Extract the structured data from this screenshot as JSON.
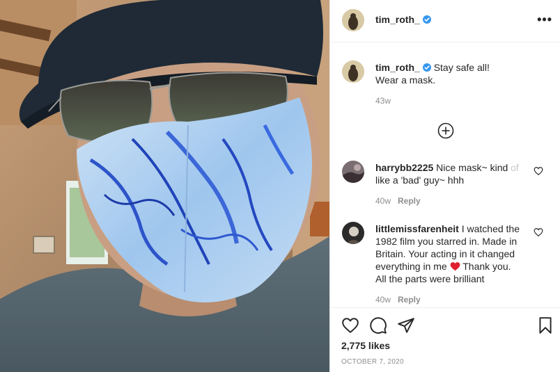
{
  "post": {
    "author": "tim_roth_",
    "more_label": "•••",
    "caption_line1": "Stay safe all!",
    "caption_line2": "Wear a mask.",
    "caption_time": "43w"
  },
  "comments": [
    {
      "user": "harrybb2225",
      "text_line1": "Nice mask~ kind ",
      "text_fade": "of",
      "text_line2": "like a 'bad' guy~ hhh",
      "time": "40w",
      "reply": "Reply"
    },
    {
      "user": "littlemissfarenheit",
      "text_line1": " I watched the",
      "text_line2": "1982 film you starred in. Made in",
      "text_line3": "Britain. Your acting in it changed",
      "text_line4": "everything in me ",
      "text_after_heart": " Thank you.",
      "text_line5": "All the parts were brilliant",
      "time": "40w",
      "reply": "Reply"
    }
  ],
  "stats": {
    "likes": "2,775 likes",
    "date": "OCTOBER 7, 2020"
  },
  "icons": {
    "verified": "verified-badge-icon",
    "load_more": "plus-circle-icon",
    "like": "heart-icon",
    "comment": "comment-bubble-icon",
    "share": "paper-plane-icon",
    "save": "bookmark-icon"
  },
  "colors": {
    "verified_blue": "#3897f0",
    "heart_red": "#ed4956",
    "muted_text": "#8e8e8e"
  }
}
